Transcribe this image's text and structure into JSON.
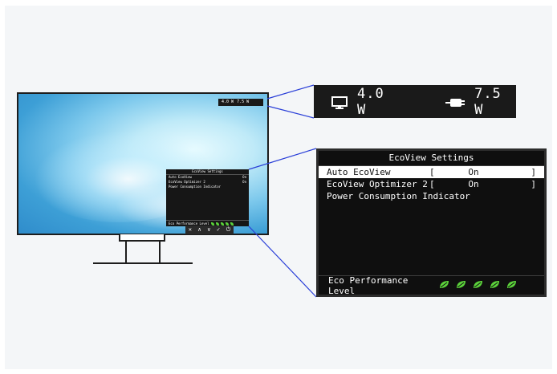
{
  "power_indicator": {
    "monitor_icon": "monitor-icon",
    "monitor_value": "4.0 W",
    "plug_icon": "plug-icon",
    "plug_value": "7.5 W"
  },
  "osd": {
    "title": "EcoView Settings",
    "rows": [
      {
        "label": "Auto EcoView",
        "open": "[",
        "value": "On",
        "close": "]"
      },
      {
        "label": "EcoView Optimizer 2",
        "open": "[",
        "value": "On",
        "close": "]"
      },
      {
        "label": "Power Consumption Indicator",
        "open": "",
        "value": "",
        "close": ""
      }
    ],
    "footer_label": "Eco Performance Level",
    "leaf_count": 5,
    "leaf_color": "#5cd23b"
  },
  "control_buttons": {
    "close": "✕",
    "up": "∧",
    "down": "∨",
    "enter": "✓",
    "power": "⏻"
  },
  "colors": {
    "callout_line": "#2a3fd8",
    "osd_background": "#0f0f0f"
  }
}
